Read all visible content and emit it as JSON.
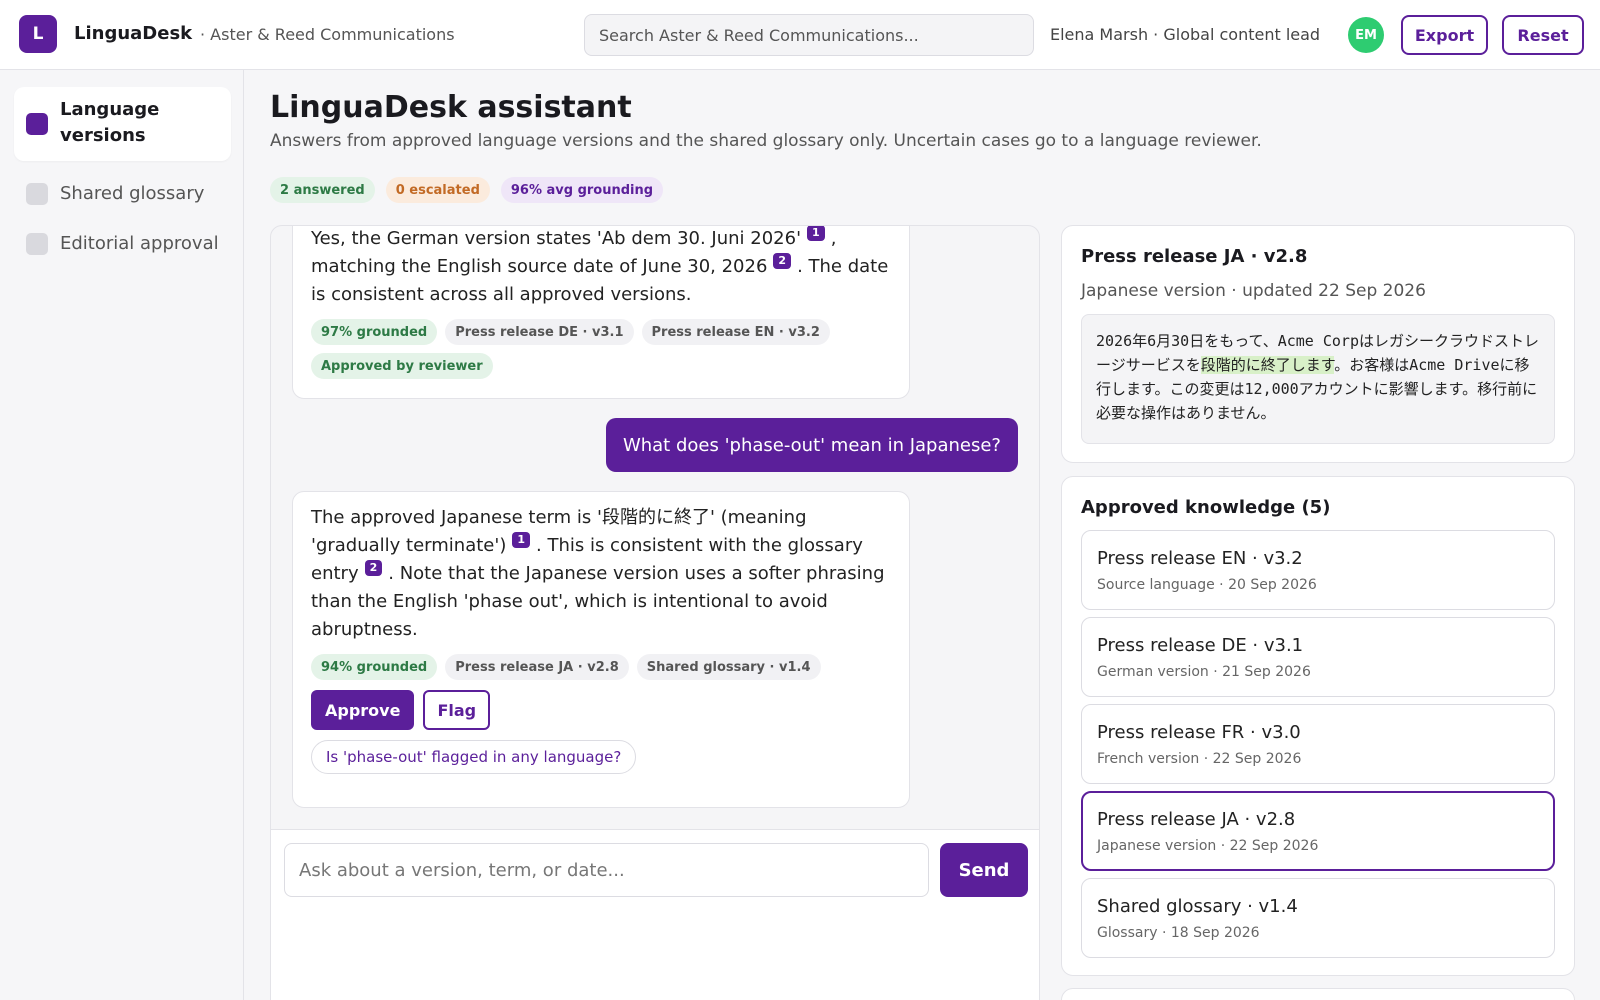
{
  "header": {
    "logo_letter": "L",
    "app_name": "LinguaDesk",
    "org_name": "· Aster & Reed Communications",
    "search_placeholder": "Search Aster & Reed Communications...",
    "user_label": "Elena Marsh · Global content lead",
    "avatar_initials": "EM",
    "export_label": "Export",
    "reset_label": "Reset"
  },
  "sidebar": {
    "items": [
      {
        "label": "Language versions",
        "active": true
      },
      {
        "label": "Shared glossary",
        "active": false
      },
      {
        "label": "Editorial approval",
        "active": false
      }
    ]
  },
  "main": {
    "title": "LinguaDesk assistant",
    "subtitle": "Answers from approved language versions and the shared glossary only. Uncertain cases go to a language reviewer.",
    "stats": {
      "answered": "2 answered",
      "escalated": "0 escalated",
      "grounding": "96% avg grounding"
    }
  },
  "chat": {
    "messages": [
      {
        "role": "assistant",
        "text_a": "Yes, the German version states 'Ab dem 30. Juni 2026'",
        "cite_a": "1",
        "text_b": ", matching the English source date of June 30, 2026",
        "cite_b": "2",
        "text_c": ". The date is consistent across all approved versions.",
        "grounded": "97% grounded",
        "sources": [
          "Press release DE · v3.1",
          "Press release EN · v3.2"
        ],
        "status": "Approved by reviewer"
      },
      {
        "role": "user",
        "text": "What does 'phase-out' mean in Japanese?"
      },
      {
        "role": "assistant",
        "text_a": "The approved Japanese term is '段階的に終了' (meaning 'gradually terminate')",
        "cite_a": "1",
        "text_b": ". This is consistent with the glossary entry",
        "cite_b": "2",
        "text_c": ". Note that the Japanese version uses a softer phrasing than the English 'phase out', which is intentional to avoid abruptness.",
        "grounded": "94% grounded",
        "sources": [
          "Press release JA · v2.8",
          "Shared glossary · v1.4"
        ],
        "approve_label": "Approve",
        "flag_label": "Flag",
        "followup": "Is 'phase-out' flagged in any language?"
      }
    ],
    "composer_placeholder": "Ask about a version, term, or date...",
    "send_label": "Send"
  },
  "document": {
    "title": "Press release JA · v2.8",
    "meta": "Japanese version · updated 22 Sep 2026",
    "body_a": "2026年6月30日をもって、Acme Corpはレガシークラウドストレージサービスを",
    "body_highlight": "段階的に終了します",
    "body_b": "。お客様はAcme Driveに移行します。この変更は12,000アカウントに影響します。移行前に必要な操作はありません。"
  },
  "knowledge": {
    "title": "Approved knowledge (5)",
    "items": [
      {
        "name": "Press release EN · v3.2",
        "sub": "Source language · 20 Sep 2026",
        "selected": false
      },
      {
        "name": "Press release DE · v3.1",
        "sub": "German version · 21 Sep 2026",
        "selected": false
      },
      {
        "name": "Press release FR · v3.0",
        "sub": "French version · 22 Sep 2026",
        "selected": false
      },
      {
        "name": "Press release JA · v2.8",
        "sub": "Japanese version · 22 Sep 2026",
        "selected": true
      },
      {
        "name": "Shared glossary · v1.4",
        "sub": "Glossary · 18 Sep 2026",
        "selected": false
      }
    ]
  },
  "colors": {
    "accent": "#5b1f9a",
    "avatar": "#2ecc71",
    "grounded_green": "#2d7a45",
    "escalated_orange": "#c26a25",
    "highlight": "#d8f0c8"
  }
}
